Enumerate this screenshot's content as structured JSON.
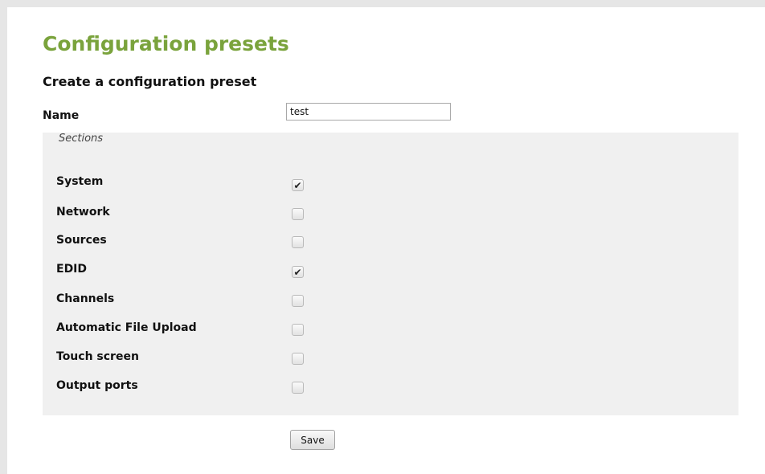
{
  "page_title": "Configuration presets",
  "subtitle": "Create a configuration preset",
  "name_field": {
    "label": "Name",
    "value": "test"
  },
  "sections": {
    "legend": "Sections",
    "items": [
      {
        "label": "System",
        "checked": true
      },
      {
        "label": "Network",
        "checked": false
      },
      {
        "label": "Sources",
        "checked": false
      },
      {
        "label": "EDID",
        "checked": true
      },
      {
        "label": "Channels",
        "checked": false
      },
      {
        "label": "Automatic File Upload",
        "checked": false
      },
      {
        "label": "Touch screen",
        "checked": false
      },
      {
        "label": "Output ports",
        "checked": false
      }
    ]
  },
  "save_label": "Save",
  "colors": {
    "title": "#7aa33c",
    "sections_bg": "#f0f0f0",
    "page_bg": "#e6e6e6"
  }
}
